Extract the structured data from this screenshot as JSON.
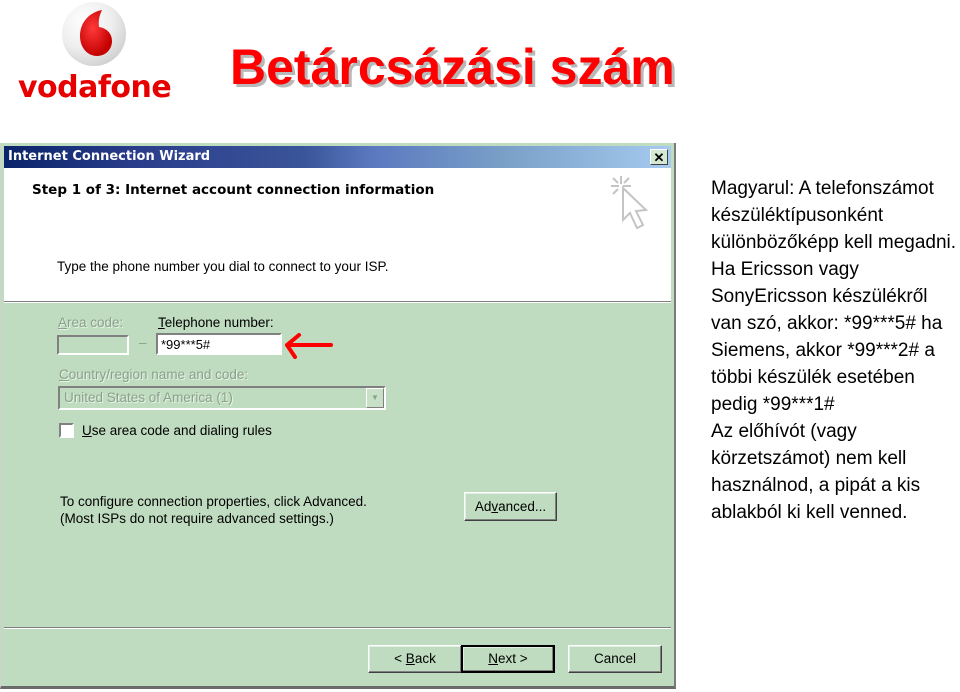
{
  "logo": {
    "brand": "vodafone",
    "icon": "vodafone-speechmark-icon",
    "color": "#e60000"
  },
  "slide": {
    "title": "Betárcsázási szám",
    "title_color": "#ff0000"
  },
  "wizard": {
    "window_title": "Internet Connection Wizard",
    "close_icon": "close-icon",
    "step_title": "Step 1 of 3: Internet account connection information",
    "header_icon": "wizard-cursor-sparkle-icon",
    "instruction": "Type the phone number you dial to connect to your ISP.",
    "area_code": {
      "label_accel": "A",
      "label_rest": "rea code:",
      "value": "",
      "disabled": true
    },
    "dash": "–",
    "telephone": {
      "label_accel": "T",
      "label_rest": "elephone number:",
      "value": "*99***5#"
    },
    "annotation_arrow": "red-arrow-icon",
    "country": {
      "label_accel": "C",
      "label_rest": "ountry/region name and code:",
      "value": "United States of America (1)",
      "disabled": true
    },
    "use_area_code": {
      "label_accel": "U",
      "label_rest": "se area code and dialing rules",
      "checked": false
    },
    "config_text_line1": "To configure connection properties, click Advanced.",
    "config_text_line2": "(Most ISPs do not require advanced settings.)",
    "buttons": {
      "advanced_pre": "Ad",
      "advanced_accel": "v",
      "advanced_post": "anced...",
      "back_pre": "< ",
      "back_accel": "B",
      "back_post": "ack",
      "next_accel": "N",
      "next_post": "ext >",
      "cancel": "Cancel"
    },
    "colors": {
      "dialog_bg": "#c0dcc0",
      "titlebar_start": "#0a246a",
      "titlebar_end": "#a6caf0"
    }
  },
  "side_text": {
    "paragraph1": "Magyarul: A telefonszámot készüléktípusonként különbözőképp kell megadni. Ha Ericsson vagy SonyEricsson készülékről van szó, akkor: *99***5# ha Siemens, akkor *99***2# a többi készülék esetében pedig *99***1#",
    "paragraph2": "Az előhívót (vagy körzetszámot) nem kell használnod, a pipát a kis ablakból ki kell venned."
  }
}
